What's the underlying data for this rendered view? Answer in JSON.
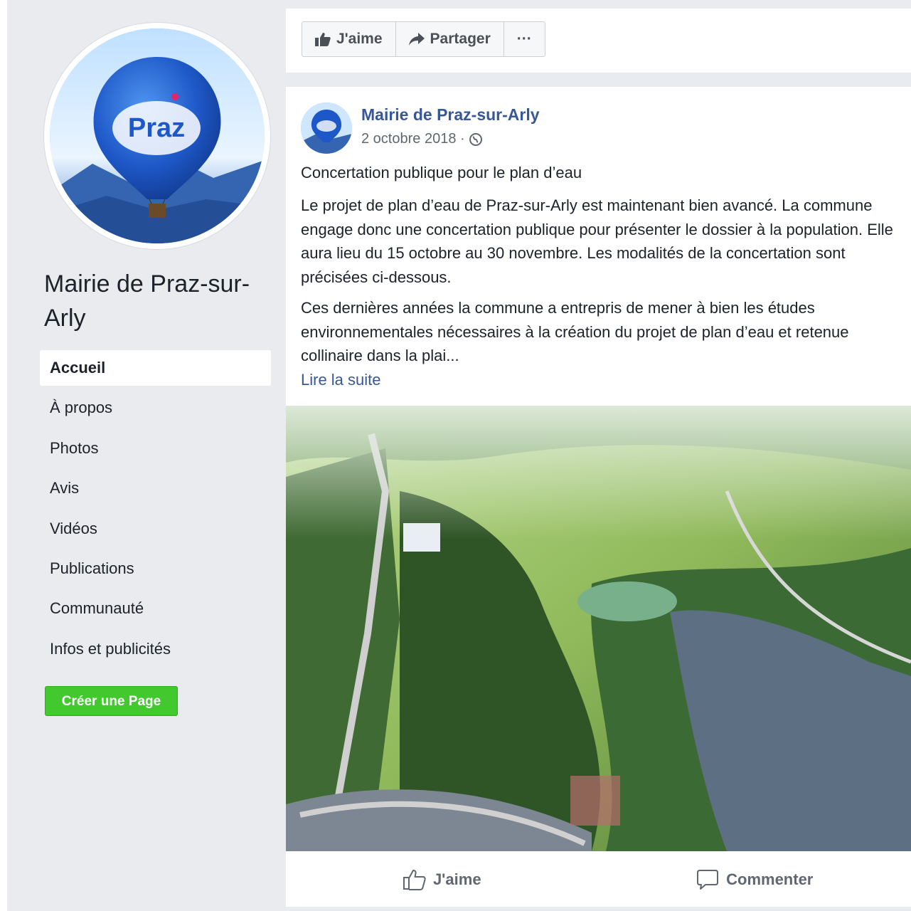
{
  "sidebar": {
    "page_name": "Mairie de Praz-sur-Arly",
    "avatar_logo": "Praz",
    "nav": [
      {
        "label": "Accueil",
        "active": true
      },
      {
        "label": "À propos",
        "active": false
      },
      {
        "label": "Photos",
        "active": false
      },
      {
        "label": "Avis",
        "active": false
      },
      {
        "label": "Vidéos",
        "active": false
      },
      {
        "label": "Publications",
        "active": false
      },
      {
        "label": "Communauté",
        "active": false
      },
      {
        "label": "Infos et publicités",
        "active": false
      }
    ],
    "create_page_label": "Créer une Page"
  },
  "toolbar": {
    "like_label": "J'aime",
    "share_label": "Partager",
    "more_label": "···"
  },
  "post": {
    "author": "Mairie de Praz-sur-Arly",
    "date": "2 octobre 2018 ·",
    "title": "Concertation publique pour le plan d’eau",
    "paragraph_1": "Le projet de plan d’eau de Praz-sur-Arly est maintenant bien avancé. La commune engage donc une concertation publique pour présenter le dossier à la population. Elle aura lieu du 15 octobre au 30 novembre. Les modalités de la concertation sont précisées ci-dessous.",
    "paragraph_2": "Ces dernières années la commune a entrepris de mener à bien les études environnementales nécessaires à la création du projet de plan d’eau et retenue collinaire dans la plai...",
    "read_more": "Lire la suite",
    "actions": {
      "like": "J'aime",
      "comment": "Commenter"
    }
  },
  "icons": {
    "thumb": "thumbs-up-icon",
    "share": "share-arrow-icon",
    "globe": "globe-icon",
    "comment": "comment-bubble-icon"
  },
  "colors": {
    "link_blue": "#365899",
    "create_green": "#42c92e",
    "background": "#e9ebee"
  }
}
